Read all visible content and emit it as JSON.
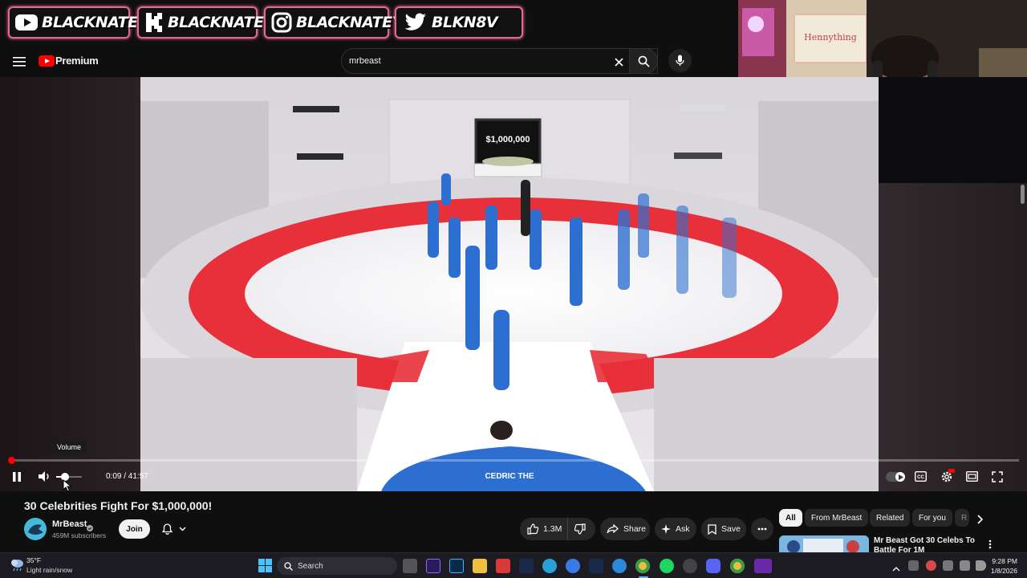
{
  "overlay": {
    "socials": [
      {
        "platform": "youtube-icon",
        "handle": "BLACKNATE"
      },
      {
        "platform": "kick-icon",
        "handle": "BLACKNATE"
      },
      {
        "platform": "instagram-icon",
        "handle": "BLACKNATEYT"
      },
      {
        "platform": "twitter-icon",
        "handle": "BLKN8V"
      }
    ]
  },
  "youtube": {
    "logo_text": "Premium",
    "search_value": "mrbeast"
  },
  "player": {
    "tooltip": "Volume",
    "time": "0:09 / 41:57",
    "progress": 0.0036,
    "volume": 0.35,
    "scene_text": "$1,000,000"
  },
  "video": {
    "title": "30 Celebrities Fight For $1,000,000!",
    "channel": "MrBeast",
    "subscribers": "459M subscribers",
    "join_label": "Join",
    "like_count": "1.3M",
    "share_label": "Share",
    "ask_label": "Ask",
    "save_label": "Save"
  },
  "sidebar": {
    "chips": [
      "All",
      "From MrBeast",
      "Related",
      "For you",
      "R"
    ],
    "rec_title_line1": "Mr Beast Got 30 Celebs To",
    "rec_title_line2": "Battle For 1M"
  },
  "taskbar": {
    "weather_temp": "35°F",
    "weather_desc": "Light rain/snow",
    "search_label": "Search",
    "time": "9:28 PM",
    "date": "1/8/2026"
  },
  "colors": {
    "accent_red": "#ff0000",
    "banner_border": "#e26a8c",
    "room_red": "#e8303a"
  }
}
